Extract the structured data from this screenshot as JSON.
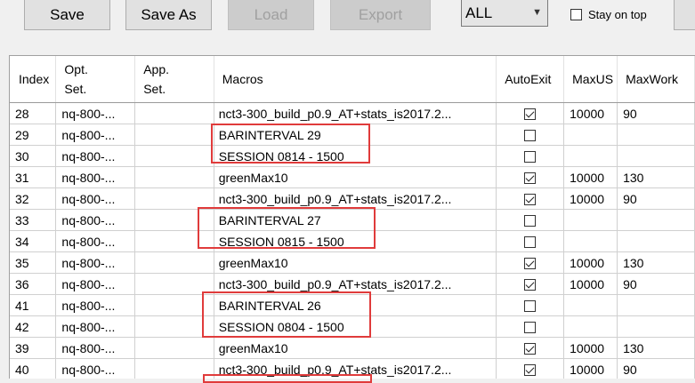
{
  "toolbar": {
    "save_label": "Save",
    "save_as_label": "Save As",
    "load_label": "Load",
    "export_label": "Export",
    "filter_value": "ALL",
    "stay_on_top_label": "Stay on top",
    "stay_on_top_checked": false
  },
  "table": {
    "columns": [
      "Index",
      "Opt.\nSet.",
      "App.\nSet.",
      "Macros",
      "AutoExit",
      "MaxUS",
      "MaxWork"
    ],
    "rows": [
      {
        "index": "28",
        "opt": "nq-800-...",
        "app": "",
        "macro": "nct3-300_build_p0.9_AT+stats_is2017.2...",
        "auto": true,
        "maxus": "10000",
        "maxwork": "90"
      },
      {
        "index": "29",
        "opt": "nq-800-...",
        "app": "",
        "macro": "BARINTERVAL 29",
        "auto": false,
        "maxus": "",
        "maxwork": ""
      },
      {
        "index": "30",
        "opt": "nq-800-...",
        "app": "",
        "macro": "SESSION 0814 - 1500",
        "auto": false,
        "maxus": "",
        "maxwork": ""
      },
      {
        "index": "31",
        "opt": "nq-800-...",
        "app": "",
        "macro": "greenMax10",
        "auto": true,
        "maxus": "10000",
        "maxwork": "130"
      },
      {
        "index": "32",
        "opt": "nq-800-...",
        "app": "",
        "macro": "nct3-300_build_p0.9_AT+stats_is2017.2...",
        "auto": true,
        "maxus": "10000",
        "maxwork": "90"
      },
      {
        "index": "33",
        "opt": "nq-800-...",
        "app": "",
        "macro": "BARINTERVAL 27",
        "auto": false,
        "maxus": "",
        "maxwork": ""
      },
      {
        "index": "34",
        "opt": "nq-800-...",
        "app": "",
        "macro": "SESSION 0815 - 1500",
        "auto": false,
        "maxus": "",
        "maxwork": ""
      },
      {
        "index": "35",
        "opt": "nq-800-...",
        "app": "",
        "macro": "greenMax10",
        "auto": true,
        "maxus": "10000",
        "maxwork": "130"
      },
      {
        "index": "36",
        "opt": "nq-800-...",
        "app": "",
        "macro": "nct3-300_build_p0.9_AT+stats_is2017.2...",
        "auto": true,
        "maxus": "10000",
        "maxwork": "90"
      },
      {
        "index": "41",
        "opt": "nq-800-...",
        "app": "",
        "macro": "BARINTERVAL 26",
        "auto": false,
        "maxus": "",
        "maxwork": ""
      },
      {
        "index": "42",
        "opt": "nq-800-...",
        "app": "",
        "macro": "SESSION 0804 - 1500",
        "auto": false,
        "maxus": "",
        "maxwork": ""
      },
      {
        "index": "39",
        "opt": "nq-800-...",
        "app": "",
        "macro": "greenMax10",
        "auto": true,
        "maxus": "10000",
        "maxwork": "130"
      },
      {
        "index": "40",
        "opt": "nq-800-...",
        "app": "",
        "macro": "nct3-300_build_p0.9_AT+stats_is2017.2...",
        "auto": true,
        "maxus": "10000",
        "maxwork": "90"
      }
    ]
  },
  "annotation_color": "#e03b3b"
}
